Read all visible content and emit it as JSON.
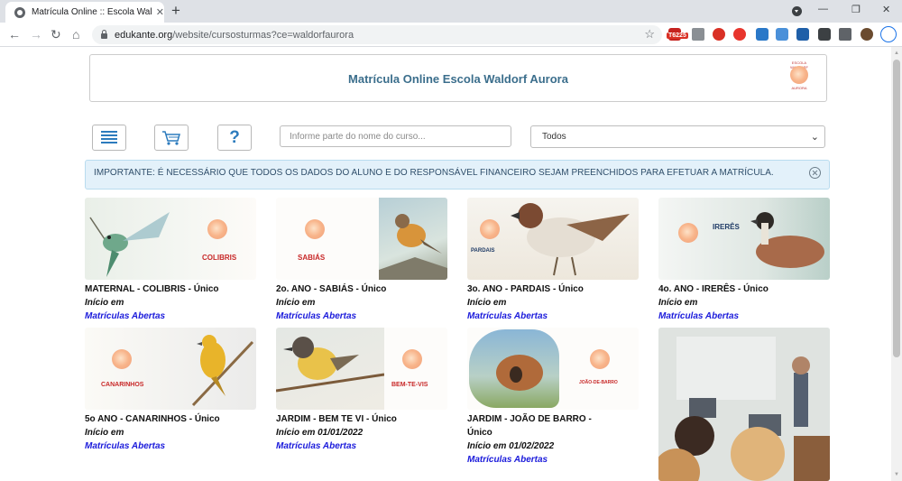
{
  "browser": {
    "tab_title": "Matrícula Online :: Escola Waldorf Aurora",
    "url_host": "edukante.org",
    "url_path": "/website/cursosturmas?ce=waldorfaurora",
    "ext_badge": "T6225"
  },
  "header": {
    "title": "Matrícula Online Escola Waldorf Aurora",
    "logo_top": "ESCOLA WALDORF",
    "logo_bottom": "AURORA"
  },
  "filters": {
    "search_placeholder": "Informe parte do nome do curso...",
    "select_value": "Todos"
  },
  "alert": {
    "text": "IMPORTANTE: É NECESSÁRIO QUE TODOS OS DADOS DO ALUNO E DO RESPONSÁVEL FINANCEIRO SEJAM PREENCHIDOS PARA EFETUAR A MATRÍCULA."
  },
  "courses": [
    {
      "title": "MATERNAL - COLIBRIS - Único",
      "start": "Início em",
      "status": "Matrículas Abertas",
      "class_label": "COLIBRIS"
    },
    {
      "title": "2o. ANO - SABIÁS - Único",
      "start": "Início em",
      "status": "Matrículas Abertas",
      "class_label": "SABIÁS"
    },
    {
      "title": "3o. ANO - PARDAIS - Único",
      "start": "Início em",
      "status": "Matrículas Abertas",
      "class_label": "PARDAIS"
    },
    {
      "title": "4o. ANO - IRERÊS - Único",
      "start": "Início em",
      "status": "Matrículas Abertas",
      "class_label": "IRERÊS"
    },
    {
      "title": "5o ANO - CANARINHOS - Único",
      "start": "Início em",
      "status": "Matrículas Abertas",
      "class_label": "CANARINHOS"
    },
    {
      "title": "JARDIM - BEM TE VI - Único",
      "start": "Início em 01/01/2022",
      "status": "Matrículas Abertas",
      "class_label": "BEM-TE-VIS"
    },
    {
      "title": "JARDIM - JOÃO DE BARRO - Único",
      "start": "Início em 01/02/2022",
      "status": "Matrículas Abertas",
      "class_label": "JOÃO-DE-BARRO"
    }
  ]
}
